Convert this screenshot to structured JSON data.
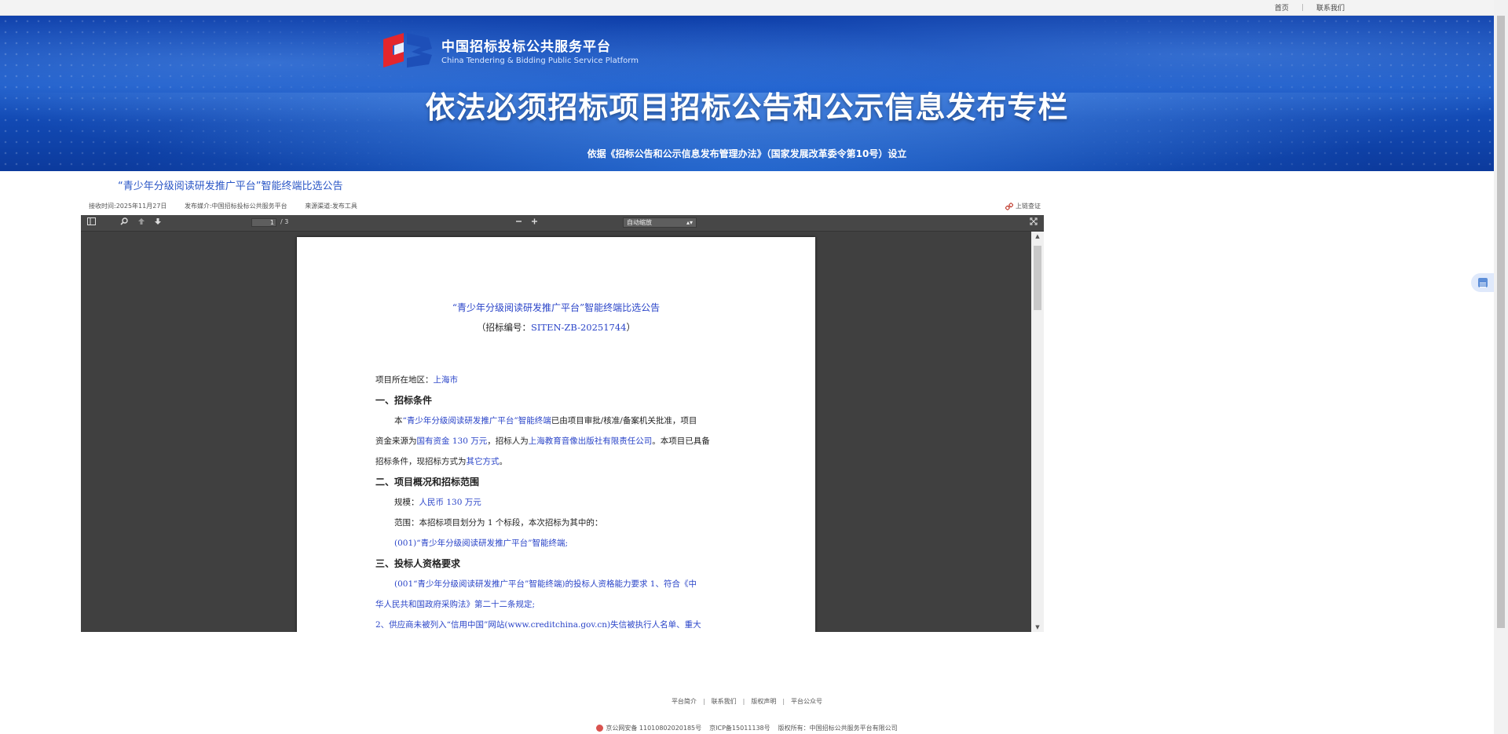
{
  "topbar": {
    "links": [
      "首页",
      "联系我们"
    ]
  },
  "banner": {
    "logo_title": "中国招标投标公共服务平台",
    "logo_subtitle": "China Tendering & Bidding Public Service Platform",
    "title": "依法必须招标项目招标公告和公示信息发布专栏",
    "note": "依据《招标公告和公示信息发布管理办法》（国家发展改革委令第10号）设立"
  },
  "page": {
    "heading": "“青少年分级阅读研发推广平台”智能终端比选公告",
    "meta": {
      "received": "接收时间:2025年11月27日",
      "media": "发布媒介:中国招标投标公共服务平台",
      "source": "来源渠道:发布工具",
      "original_link": "上链查证"
    }
  },
  "pdf": {
    "page_current": "1",
    "page_total": "/ 3",
    "zoom": "自动缩放",
    "doc": {
      "title": "“青少年分级阅读研发推广平台”智能终端比选公告",
      "subtitle_prefix": "（招标编号：",
      "subtitle_number": "SITEN-ZB-20251744",
      "subtitle_suffix": "）",
      "lines": {
        "location_label": "项目所在地区：",
        "location_value": "上海市",
        "sec1": "一、招标条件",
        "p1a_pre": "本",
        "p1a_blue": "“青少年分级阅读研发推广平台”智能终端",
        "p1a_post": "已由项目审批/核准/备案机关批准，项目",
        "p1b_pre": "资金来源为",
        "p1b_blue1": "国有资金 130 万元",
        "p1b_mid": "，招标人为",
        "p1b_blue2": "上海教育音像出版社有限责任公司",
        "p1b_post": "。本项目已具备",
        "p1c_pre": "招标条件，现招标方式为",
        "p1c_blue": "其它方式",
        "p1c_post": "。",
        "sec2": "二、项目概况和招标范围",
        "scale_label": "规模：",
        "scale_value": "人民币 130 万元",
        "scope": "范围：本招标项目划分为 1 个标段，本次招标为其中的：",
        "lot": "(001)“青少年分级阅读研发推广平台”智能终端;",
        "sec3": "三、投标人资格要求",
        "q1": "(001“青少年分级阅读研发推广平台”智能终端)的投标人资格能力要求 1、符合《中",
        "q2": "华人民共和国政府采购法》第二十二条规定;",
        "q3": "2、供应商未被列入“信用中国”网站(www.creditchina.gov.cn)失信被执行人名单、重大"
      }
    }
  },
  "footer": {
    "links": [
      "平台简介",
      "联系我们",
      "版权声明",
      "平台公众号"
    ],
    "police": "京公网安备 11010802020185号",
    "icp": "京ICP备15011138号",
    "copyright": "版权所有：中国招标公共服务平台有限公司"
  },
  "colors": {
    "link_blue": "#2a56c6",
    "doc_blue": "#2a44c8",
    "banner_blue": "#1654c4",
    "viewer_gray": "#404040"
  }
}
